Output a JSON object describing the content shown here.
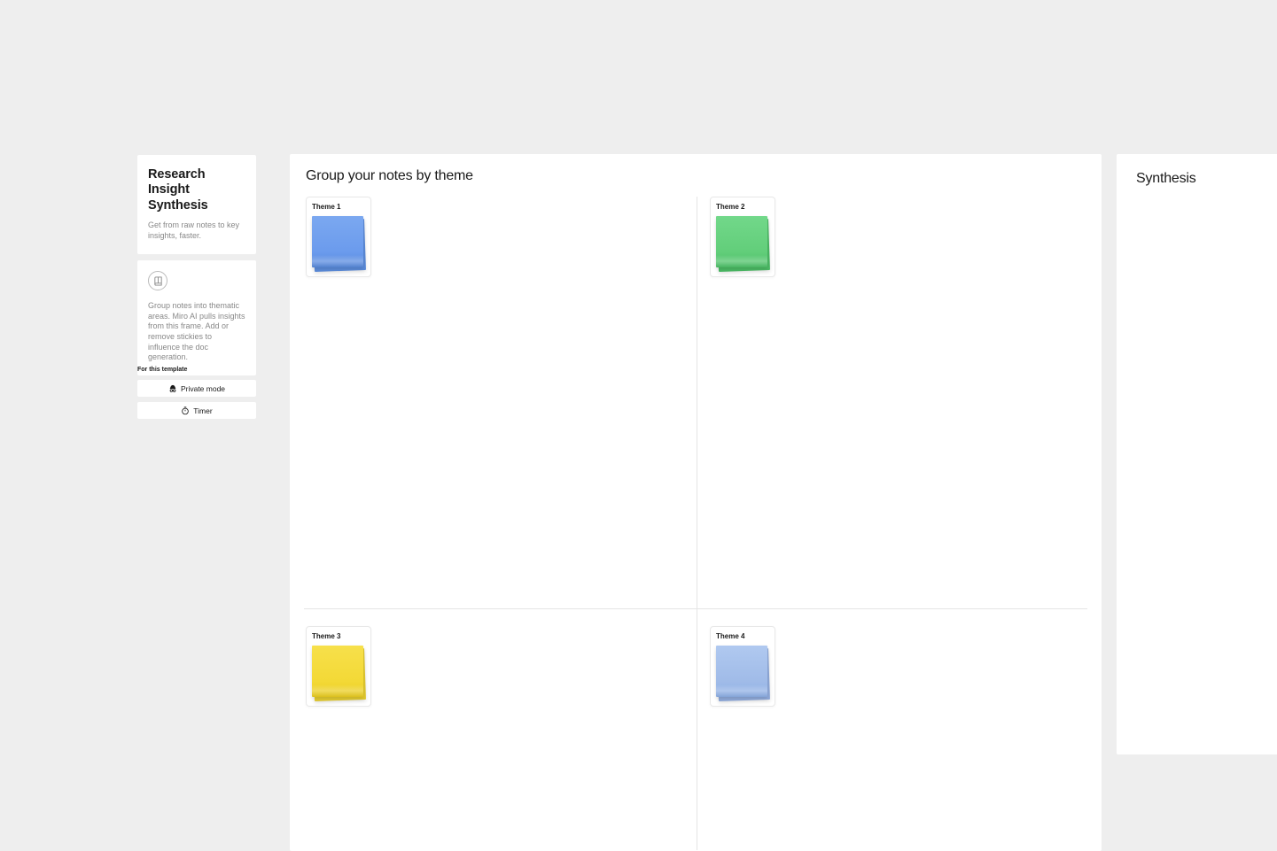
{
  "sidebar": {
    "title": "Research Insight Synthesis",
    "subtitle": "Get from raw notes to key insights, faster.",
    "instruction": "Group notes into thematic areas. Miro AI pulls insights from this frame. Add or remove stickies to influence the doc generation.",
    "section_label": "For this template",
    "private_mode_label": "Private mode",
    "timer_label": "Timer"
  },
  "main_frame": {
    "title": "Group your notes by theme",
    "themes": [
      {
        "label": "Theme 1",
        "color": "blue"
      },
      {
        "label": "Theme 2",
        "color": "green"
      },
      {
        "label": "Theme 3",
        "color": "yellow"
      },
      {
        "label": "Theme 4",
        "color": "lightblue"
      }
    ]
  },
  "right_frame": {
    "title": "Synthesis"
  }
}
